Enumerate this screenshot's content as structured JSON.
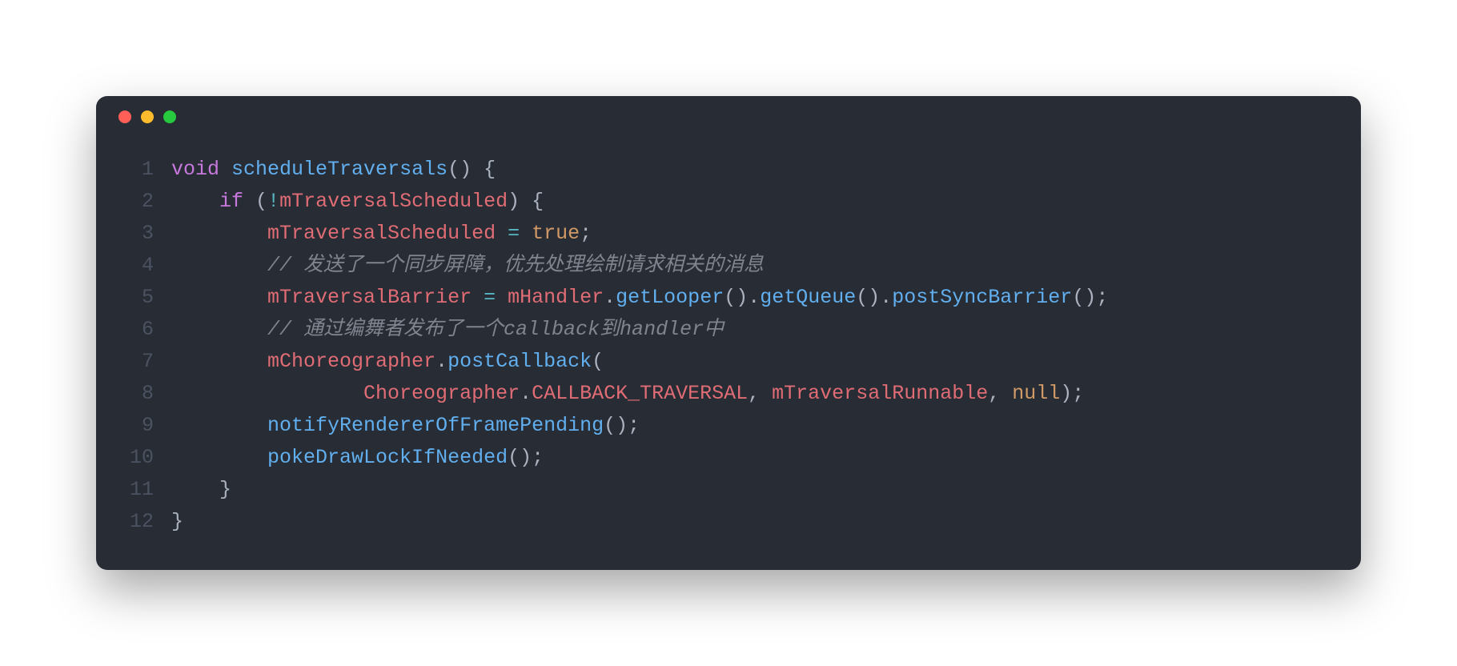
{
  "window": {
    "traffic_lights": [
      "red",
      "yellow",
      "green"
    ]
  },
  "code": {
    "language": "java",
    "line_numbers": [
      "1",
      "2",
      "3",
      "4",
      "5",
      "6",
      "7",
      "8",
      "9",
      "10",
      "11",
      "12"
    ],
    "lines": [
      {
        "indent": 0,
        "tokens": [
          {
            "t": "void",
            "c": "keyword-type"
          },
          {
            "t": " ",
            "c": "punc"
          },
          {
            "t": "scheduleTraversals",
            "c": "func"
          },
          {
            "t": "()",
            "c": "punc"
          },
          {
            "t": " ",
            "c": "punc"
          },
          {
            "t": "{",
            "c": "punc"
          }
        ]
      },
      {
        "indent": 1,
        "tokens": [
          {
            "t": "if",
            "c": "keyword"
          },
          {
            "t": " ",
            "c": "punc"
          },
          {
            "t": "(",
            "c": "punc"
          },
          {
            "t": "!",
            "c": "op"
          },
          {
            "t": "mTraversalScheduled",
            "c": "ident"
          },
          {
            "t": ")",
            "c": "punc"
          },
          {
            "t": " ",
            "c": "punc"
          },
          {
            "t": "{",
            "c": "punc"
          }
        ]
      },
      {
        "indent": 2,
        "tokens": [
          {
            "t": "mTraversalScheduled",
            "c": "ident"
          },
          {
            "t": " ",
            "c": "punc"
          },
          {
            "t": "=",
            "c": "op"
          },
          {
            "t": " ",
            "c": "punc"
          },
          {
            "t": "true",
            "c": "const"
          },
          {
            "t": ";",
            "c": "punc"
          }
        ]
      },
      {
        "indent": 2,
        "tokens": [
          {
            "t": "// 发送了一个同步屏障，优先处理绘制请求相关的消息",
            "c": "comment"
          }
        ]
      },
      {
        "indent": 2,
        "tokens": [
          {
            "t": "mTraversalBarrier",
            "c": "ident"
          },
          {
            "t": " ",
            "c": "punc"
          },
          {
            "t": "=",
            "c": "op"
          },
          {
            "t": " ",
            "c": "punc"
          },
          {
            "t": "mHandler",
            "c": "ident"
          },
          {
            "t": ".",
            "c": "punc"
          },
          {
            "t": "getLooper",
            "c": "func"
          },
          {
            "t": "().",
            "c": "punc"
          },
          {
            "t": "getQueue",
            "c": "func"
          },
          {
            "t": "().",
            "c": "punc"
          },
          {
            "t": "postSyncBarrier",
            "c": "func"
          },
          {
            "t": "();",
            "c": "punc"
          }
        ]
      },
      {
        "indent": 2,
        "tokens": [
          {
            "t": "// 通过编舞者发布了一个callback到handler中",
            "c": "comment"
          }
        ]
      },
      {
        "indent": 2,
        "tokens": [
          {
            "t": "mChoreographer",
            "c": "ident"
          },
          {
            "t": ".",
            "c": "punc"
          },
          {
            "t": "postCallback",
            "c": "func"
          },
          {
            "t": "(",
            "c": "punc"
          }
        ]
      },
      {
        "indent": 4,
        "tokens": [
          {
            "t": "Choreographer",
            "c": "ident"
          },
          {
            "t": ".",
            "c": "punc"
          },
          {
            "t": "CALLBACK_TRAVERSAL",
            "c": "ident"
          },
          {
            "t": ", ",
            "c": "punc"
          },
          {
            "t": "mTraversalRunnable",
            "c": "ident"
          },
          {
            "t": ", ",
            "c": "punc"
          },
          {
            "t": "null",
            "c": "const"
          },
          {
            "t": ");",
            "c": "punc"
          }
        ]
      },
      {
        "indent": 2,
        "tokens": [
          {
            "t": "notifyRendererOfFramePending",
            "c": "func"
          },
          {
            "t": "();",
            "c": "punc"
          }
        ]
      },
      {
        "indent": 2,
        "tokens": [
          {
            "t": "pokeDrawLockIfNeeded",
            "c": "func"
          },
          {
            "t": "();",
            "c": "punc"
          }
        ]
      },
      {
        "indent": 1,
        "tokens": [
          {
            "t": "}",
            "c": "punc"
          }
        ]
      },
      {
        "indent": 0,
        "tokens": [
          {
            "t": "}",
            "c": "punc"
          }
        ]
      }
    ],
    "indent_unit": "    "
  }
}
